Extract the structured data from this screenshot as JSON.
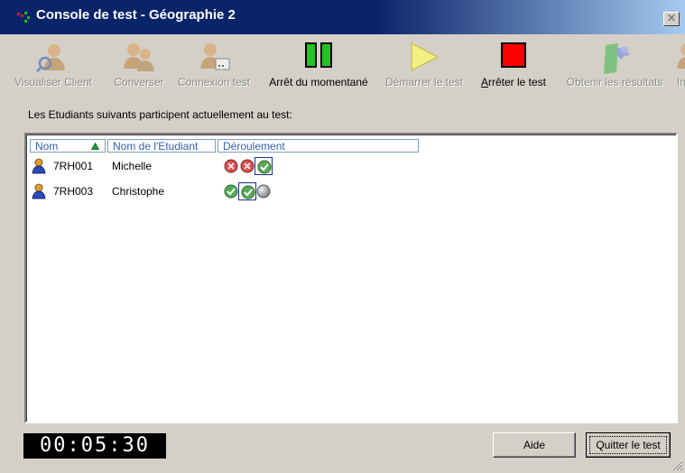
{
  "window": {
    "title": "Console de test - Géographie 2"
  },
  "toolbar": {
    "items": [
      {
        "label": "Visualiser Client",
        "enabled": false,
        "icon": "view-client-icon"
      },
      {
        "label": "Converser",
        "enabled": false,
        "icon": "chat-icon"
      },
      {
        "label": "Connexion test",
        "enabled": false,
        "icon": "connection-icon"
      },
      {
        "label": "Arrêt du momentané",
        "enabled": true,
        "icon": "pause-icon"
      },
      {
        "label": "Démarrer le test",
        "enabled": false,
        "icon": "play-icon"
      },
      {
        "label": "Arrêter le test",
        "enabled": true,
        "icon": "stop-icon"
      },
      {
        "label": "Obtenir les résultats",
        "enabled": false,
        "icon": "results-icon"
      },
      {
        "label": "In",
        "enabled": false,
        "icon": "info-icon"
      }
    ]
  },
  "prompt": "Les Etudiants suivants participent actuellement au test:",
  "list": {
    "columns": {
      "id": "Nom",
      "name": "Nom de l'Etudiant",
      "progress": "Déroulement"
    },
    "rows": [
      {
        "id": "7RH001",
        "name": "Michelle",
        "progress": [
          "fail",
          "fail",
          "pass"
        ],
        "selected_index": 2
      },
      {
        "id": "7RH003",
        "name": "Christophe",
        "progress": [
          "pass",
          "pass",
          "pending"
        ],
        "selected_index": 1
      }
    ]
  },
  "timer": "00:05:30",
  "buttons": {
    "help": "Aide",
    "quit": "Quitter le test"
  },
  "colors": {
    "titlebar": "#0a246a",
    "pause": "#22c322",
    "stop": "#ff0000",
    "play": "#f2f082",
    "header_text": "#3260b8"
  }
}
